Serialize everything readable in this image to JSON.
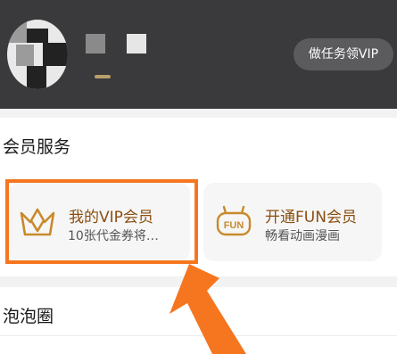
{
  "header": {
    "task_button_label": "做任务领VIP"
  },
  "member_services": {
    "title": "会员服务",
    "cards": [
      {
        "title": "我的VIP会员",
        "subtitle": "10张代金券将…",
        "icon": "crown-v-icon"
      },
      {
        "title": "开通FUN会员",
        "subtitle": "畅看动画漫画",
        "icon": "fun-badge-icon"
      }
    ]
  },
  "bubble_circle": {
    "title": "泡泡圈"
  },
  "colors": {
    "header_bg": "#3a3a3c",
    "accent_orange": "#f5761f",
    "card_title": "#8a4f12"
  }
}
